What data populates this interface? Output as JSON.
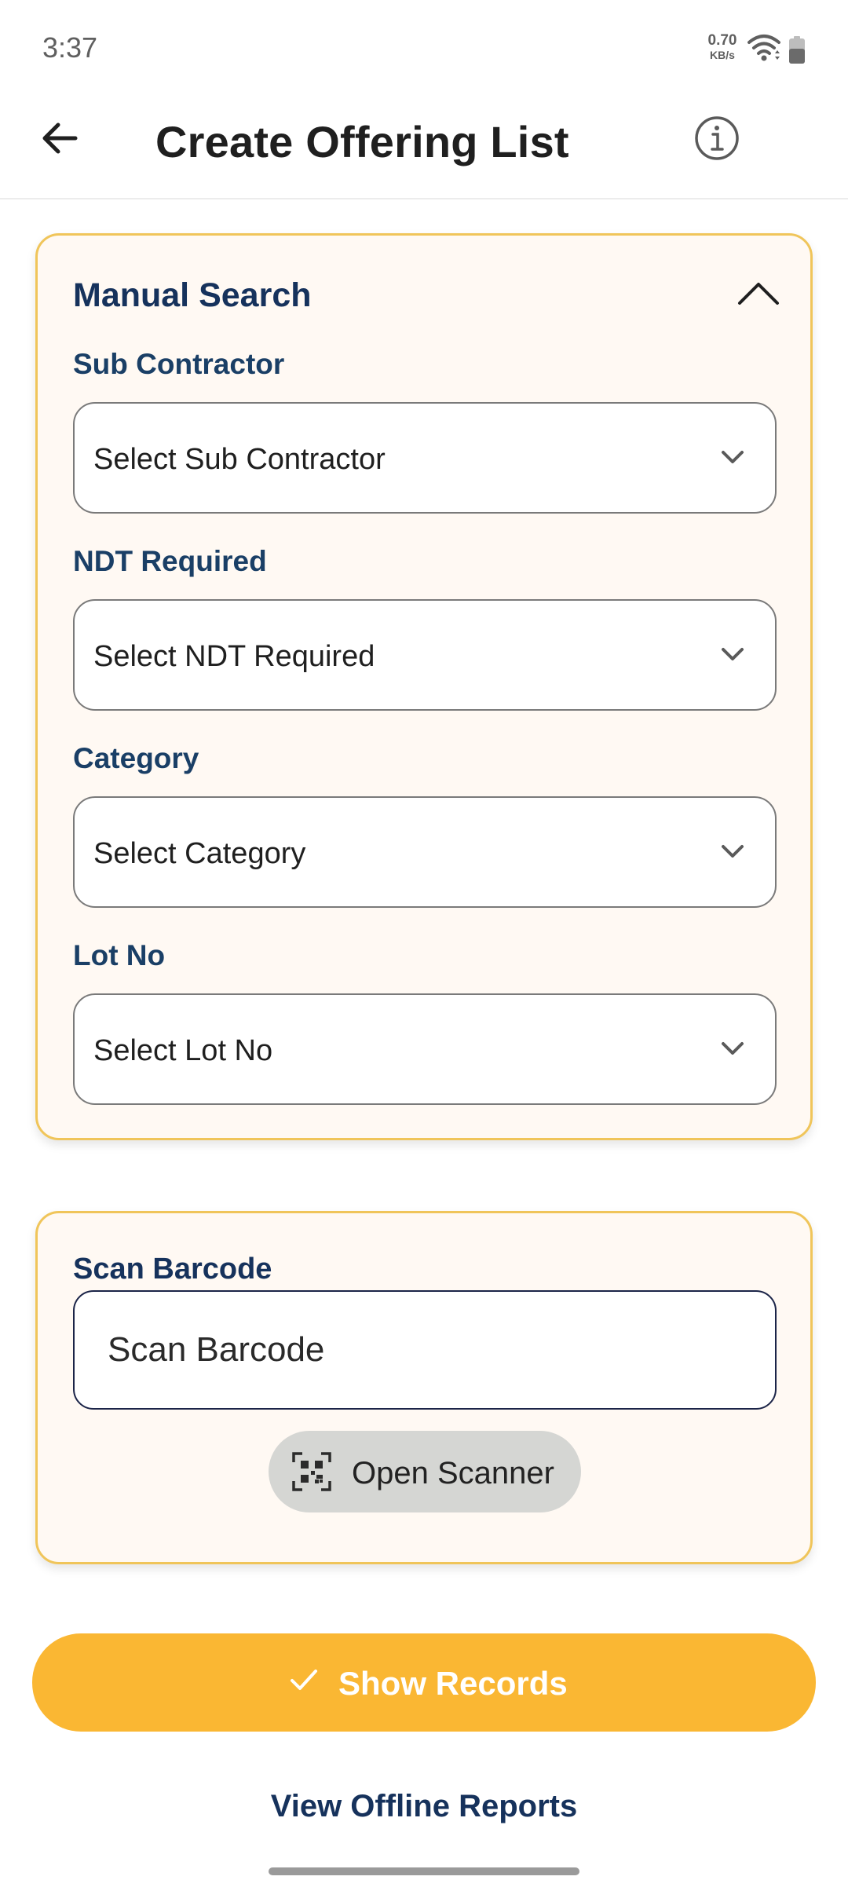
{
  "status_bar": {
    "time": "3:37",
    "net_speed_value": "0.70",
    "net_speed_unit": "KB/s",
    "icons": [
      "wifi-icon",
      "battery-icon"
    ]
  },
  "app_bar": {
    "title": "Create Offering List",
    "back_icon": "back-arrow-icon",
    "info_icon": "info-icon"
  },
  "manual_search": {
    "title": "Manual Search",
    "collapse_icon": "chevron-up-icon",
    "fields": [
      {
        "label": "Sub Contractor",
        "value": "Select Sub Contractor"
      },
      {
        "label": "NDT Required",
        "value": "Select NDT Required"
      },
      {
        "label": "Category",
        "value": "Select Category"
      },
      {
        "label": "Lot No",
        "value": "Select Lot No"
      }
    ]
  },
  "scan_barcode": {
    "label": "Scan Barcode",
    "placeholder": "Scan Barcode",
    "value": "",
    "scanner_button_label": "Open Scanner",
    "scanner_icon": "qr-code-icon"
  },
  "actions": {
    "show_records_label": "Show Records",
    "show_records_icon": "check-icon",
    "offline_reports_label": "View Offline Reports"
  },
  "colors": {
    "accent": "#fab733",
    "card_border": "#f0c55a",
    "card_background": "#fff9f3",
    "heading_blue": "#16325c",
    "label_blue": "#1a3f66"
  }
}
